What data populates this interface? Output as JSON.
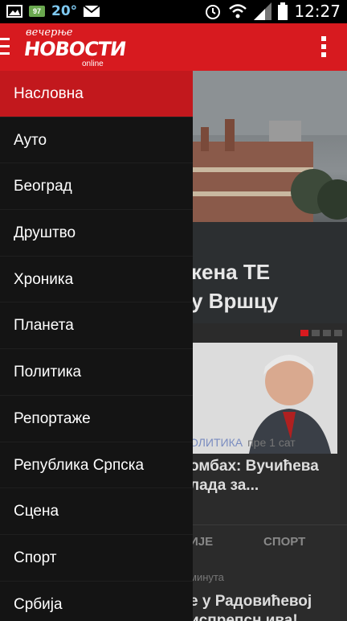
{
  "status_bar": {
    "temperature": "20°",
    "battery_badge": "97",
    "time": "12:27"
  },
  "app_bar": {
    "logo_top": "вечерње",
    "logo_main": "НОВОСТИ",
    "logo_sub": "online"
  },
  "drawer": {
    "items": [
      {
        "label": "Насловна",
        "active": true
      },
      {
        "label": "Ауто"
      },
      {
        "label": "Београд"
      },
      {
        "label": "Друштво"
      },
      {
        "label": "Хроника"
      },
      {
        "label": "Планета"
      },
      {
        "label": "Политика"
      },
      {
        "label": "Репортаже"
      },
      {
        "label": "Република Српска"
      },
      {
        "label": "Сцена"
      },
      {
        "label": "Спорт"
      },
      {
        "label": "Србија"
      }
    ]
  },
  "content": {
    "hero_title_line1": "кена ТЕ",
    "hero_title_line2": "у Вршцу",
    "card": {
      "category": "ОЛИТИКА",
      "time": "пре 1 сат",
      "headline_line1": "омбах: Вучићева",
      "headline_line2": "лада за..."
    },
    "tabs": [
      "ИЈЕ",
      "СПОРТ"
    ],
    "second": {
      "meta": "минута",
      "headline_line1": "е у Радовићевој",
      "headline_line2": "испрепсн ива!"
    }
  },
  "colors": {
    "brand_red": "#d71a1f",
    "drawer_bg": "#141414"
  }
}
